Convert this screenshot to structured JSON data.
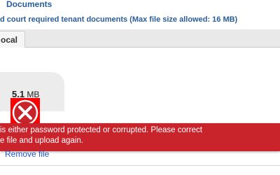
{
  "header": {
    "title": "Documents",
    "subtitle": "d court required tenant documents (Max file size allowed: 16 MB)"
  },
  "tabs": [
    {
      "label": "ocal",
      "active": true
    }
  ],
  "file": {
    "size_value": "5.1",
    "size_unit": "MB",
    "status": "error",
    "status_icon": "error-x-icon"
  },
  "error_banner": {
    "message": "is either password protected or corrupted. Please correct\ne file and upload again.",
    "color": "#c9242c"
  },
  "actions": {
    "remove_label": "Remove file"
  },
  "colors": {
    "title": "#2a5d9a",
    "link": "#2456c8",
    "error": "#c9242c"
  }
}
